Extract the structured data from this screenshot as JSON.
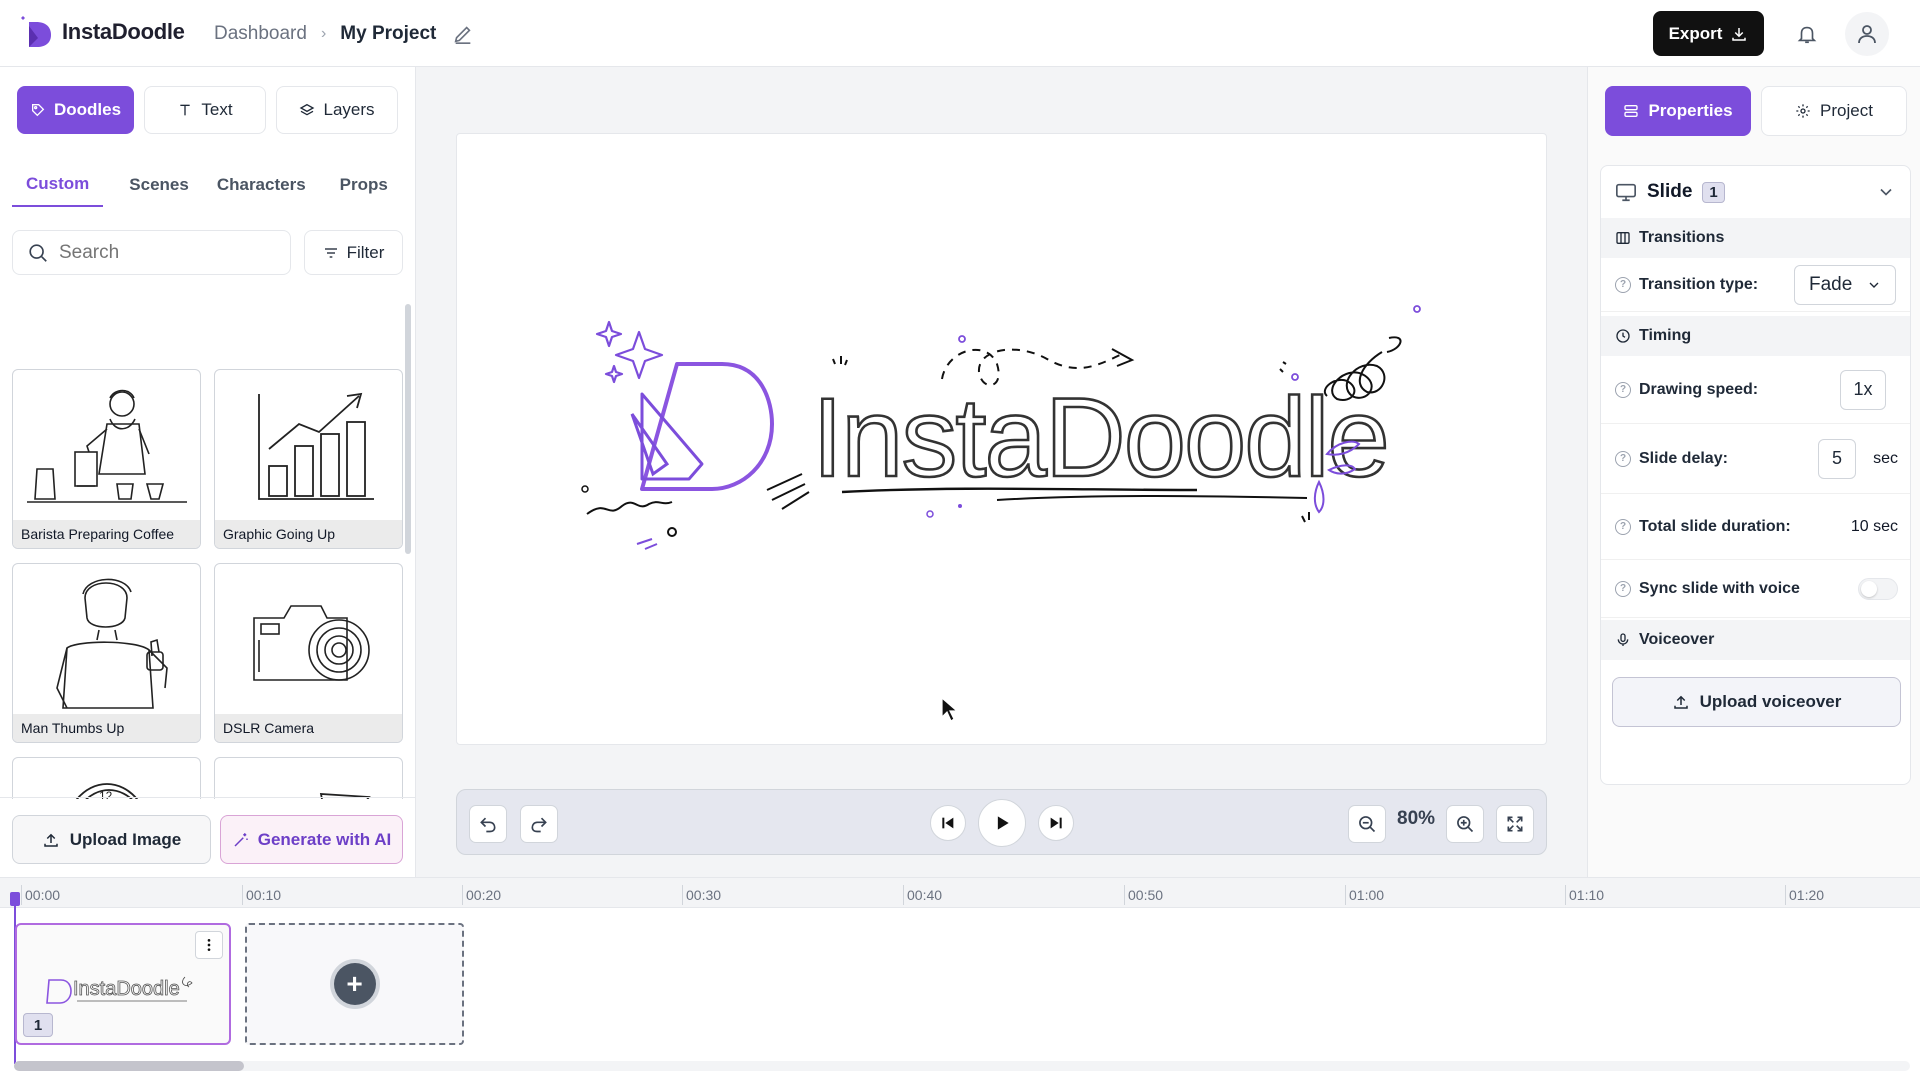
{
  "header": {
    "brand": "InstaDoodle",
    "breadcrumb_parent": "Dashboard",
    "breadcrumb_current": "My Project",
    "export_label": "Export"
  },
  "left_panel": {
    "mode_tabs": [
      {
        "label": "Doodles",
        "active": true
      },
      {
        "label": "Text",
        "active": false
      },
      {
        "label": "Layers",
        "active": false
      }
    ],
    "categories": [
      {
        "label": "Custom",
        "active": true
      },
      {
        "label": "Scenes",
        "active": false
      },
      {
        "label": "Characters",
        "active": false
      },
      {
        "label": "Props",
        "active": false
      }
    ],
    "search_placeholder": "Search",
    "filter_label": "Filter",
    "items": [
      {
        "caption": "Barista Preparing Coffee"
      },
      {
        "caption": "Graphic Going Up"
      },
      {
        "caption": "Man Thumbs Up"
      },
      {
        "caption": "DSLR Camera"
      },
      {
        "caption": ""
      },
      {
        "caption": ""
      }
    ],
    "upload_label": "Upload Image",
    "generate_label": "Generate with AI"
  },
  "canvas": {
    "logo_text": "InstaDoodle",
    "zoom": "80%"
  },
  "right_panel": {
    "tabs": [
      {
        "label": "Properties",
        "active": true
      },
      {
        "label": "Project",
        "active": false
      }
    ],
    "slide_label": "Slide",
    "slide_number": "1",
    "transitions_heading": "Transitions",
    "transition_type_label": "Transition type:",
    "transition_type_value": "Fade",
    "timing_heading": "Timing",
    "drawing_speed_label": "Drawing speed:",
    "drawing_speed_value": "1x",
    "slide_delay_label": "Slide delay:",
    "slide_delay_value": "5",
    "slide_delay_unit": "sec",
    "total_duration_label": "Total slide duration:",
    "total_duration_value": "10 sec",
    "sync_label": "Sync slide with voice",
    "sync_enabled": false,
    "voiceover_heading": "Voiceover",
    "upload_voiceover_label": "Upload voiceover"
  },
  "timeline": {
    "ticks": [
      "00:00",
      "00:10",
      "00:20",
      "00:30",
      "00:40",
      "00:50",
      "01:00",
      "01:10",
      "01:20"
    ],
    "slides": [
      {
        "number": "1"
      }
    ]
  },
  "colors": {
    "accent": "#7c4ddb",
    "dark": "#111111"
  }
}
